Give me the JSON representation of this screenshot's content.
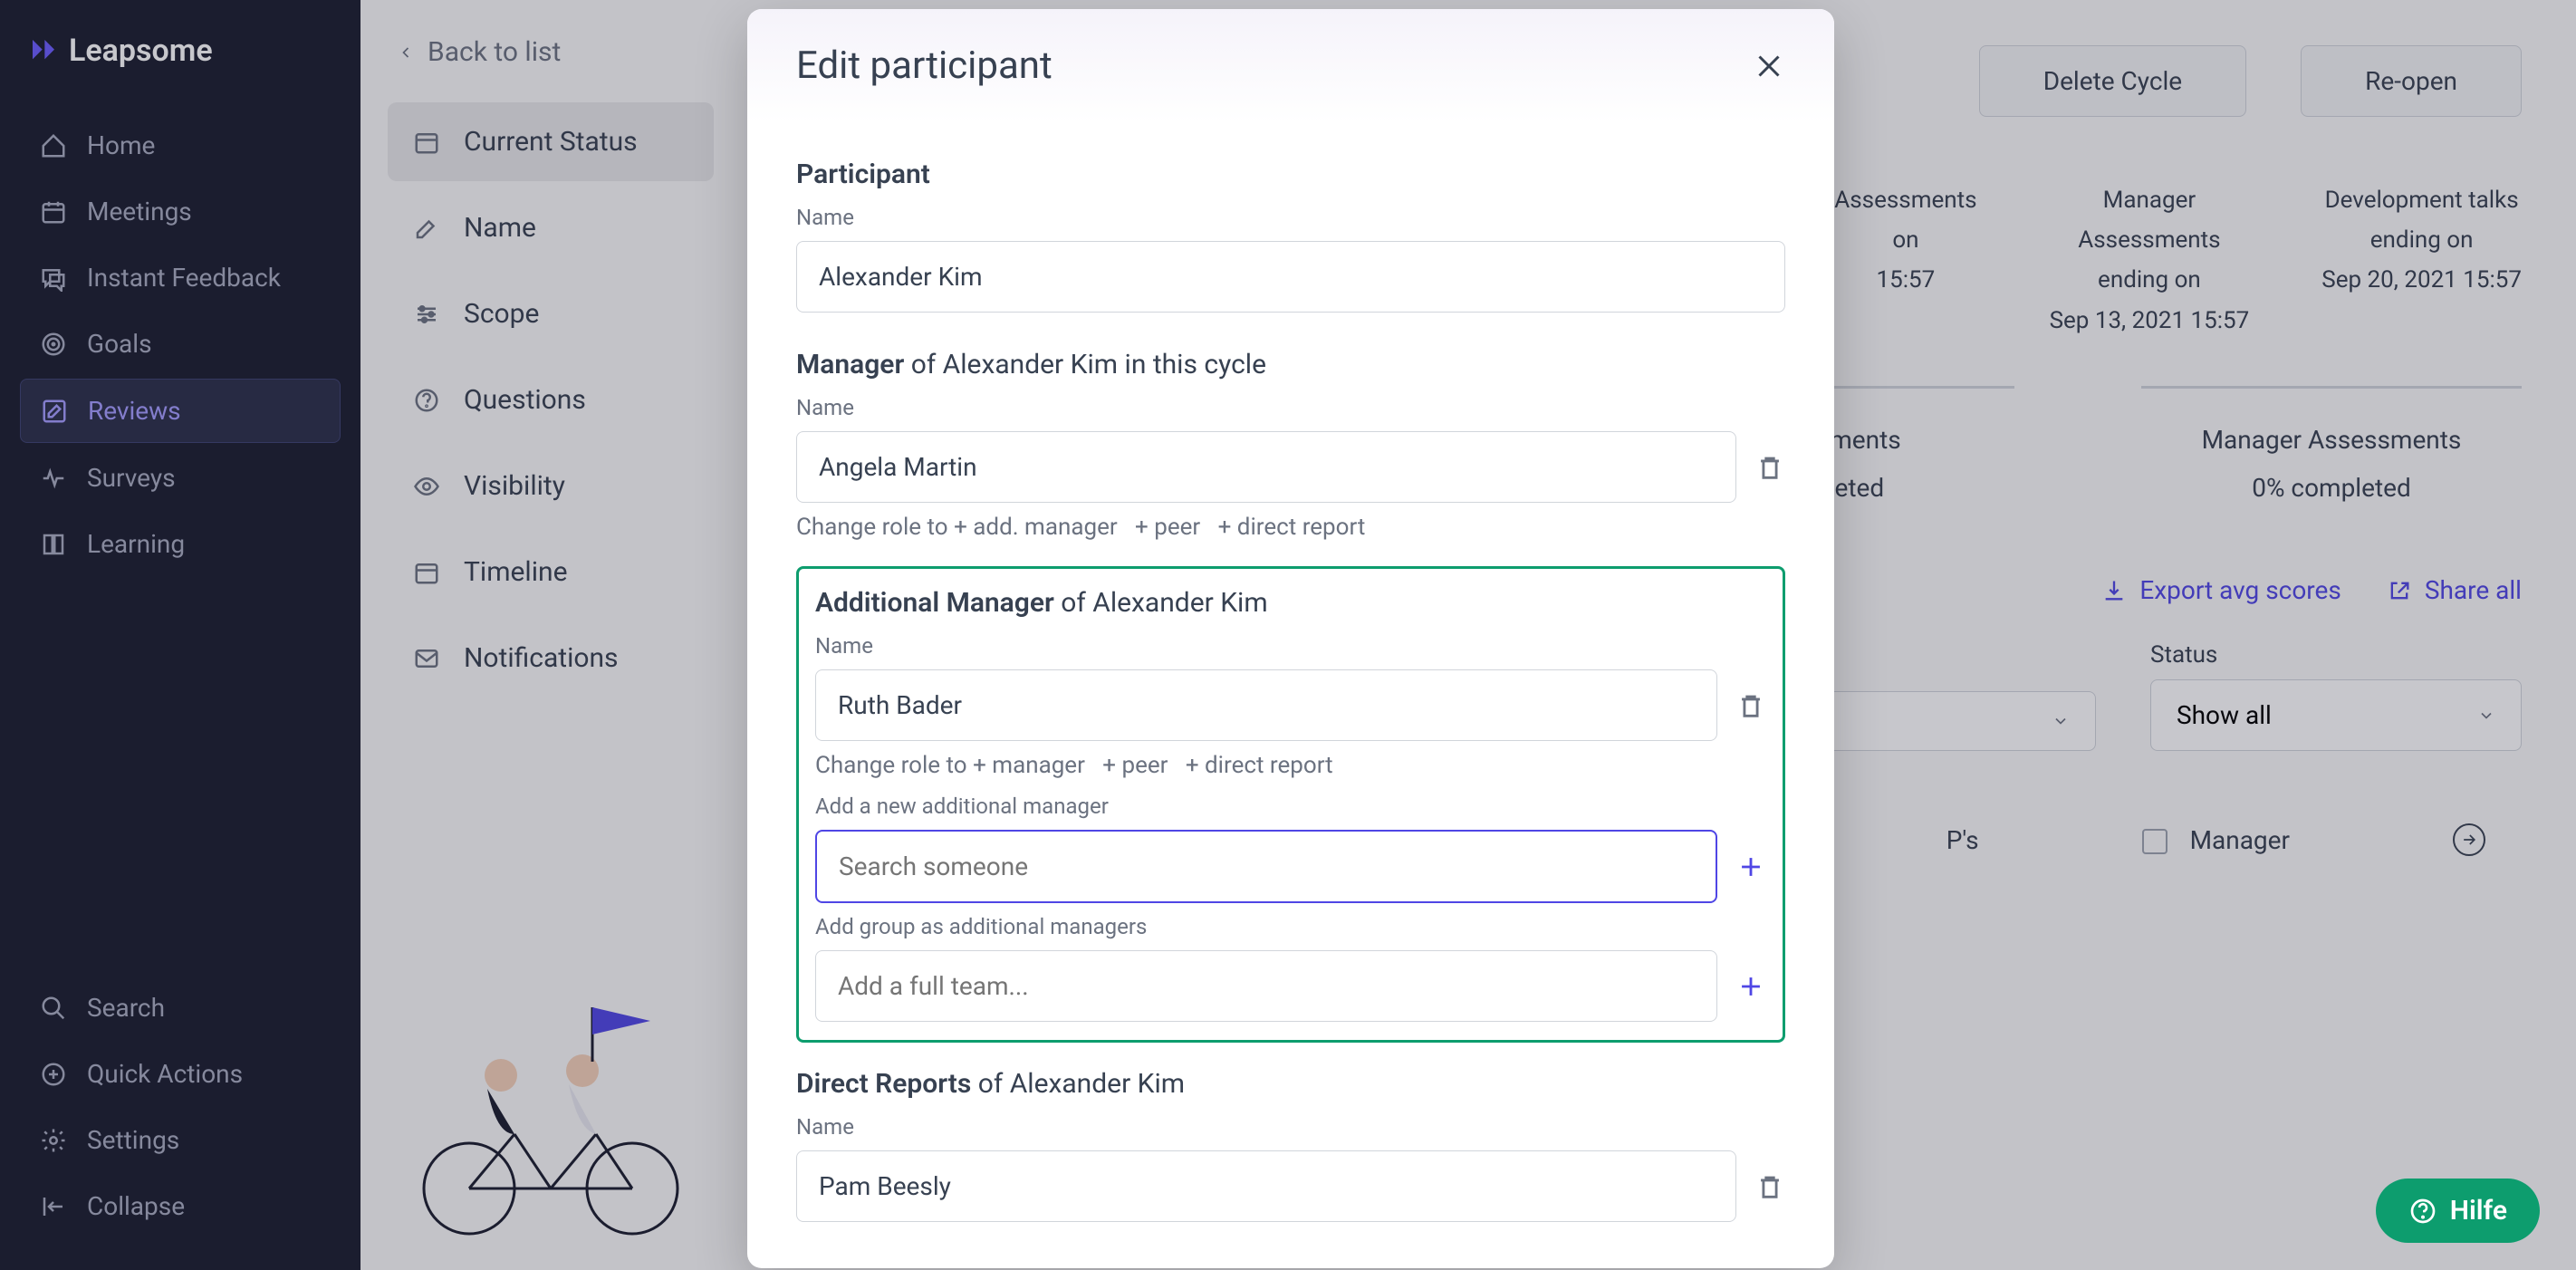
{
  "logo": "Leapsome",
  "sidebar": {
    "items": [
      {
        "label": "Home",
        "icon": "home"
      },
      {
        "label": "Meetings",
        "icon": "calendar"
      },
      {
        "label": "Instant Feedback",
        "icon": "chat"
      },
      {
        "label": "Goals",
        "icon": "target"
      },
      {
        "label": "Reviews",
        "icon": "edit",
        "active": true
      },
      {
        "label": "Surveys",
        "icon": "pulse"
      },
      {
        "label": "Learning",
        "icon": "book"
      }
    ],
    "bottom": [
      {
        "label": "Search",
        "icon": "search"
      },
      {
        "label": "Quick Actions",
        "icon": "plus-circle"
      },
      {
        "label": "Settings",
        "icon": "gear"
      },
      {
        "label": "Collapse",
        "icon": "collapse"
      }
    ]
  },
  "cycle_nav": {
    "back_label": "Back to list",
    "items": [
      {
        "label": "Current Status",
        "active": true
      },
      {
        "label": "Name"
      },
      {
        "label": "Scope"
      },
      {
        "label": "Questions"
      },
      {
        "label": "Visibility"
      },
      {
        "label": "Timeline"
      },
      {
        "label": "Notifications"
      }
    ]
  },
  "content": {
    "actions": {
      "delete": "Delete Cycle",
      "reopen": "Re-open"
    },
    "timeline": [
      {
        "l1": "Assessments",
        "l2": "on",
        "l3": "15:57"
      },
      {
        "l1": "Manager",
        "l2": "Assessments",
        "l3": "ending on",
        "l4": "Sep 13, 2021 15:57"
      },
      {
        "l1": "Development talks",
        "l2": "ending on",
        "l3": "Sep 20, 2021 15:57"
      }
    ],
    "stats": [
      {
        "title": "Assessments",
        "value": "completed"
      },
      {
        "title": "Manager Assessments",
        "value": "0% completed"
      }
    ],
    "export_links": {
      "export": "Export avg scores",
      "share": "Share all"
    },
    "filters": {
      "status_label": "Status",
      "status_value": "Show all"
    },
    "row": {
      "ps": "P's",
      "manager": "Manager"
    }
  },
  "modal": {
    "title": "Edit participant",
    "participant": {
      "heading": "Participant",
      "name_label": "Name",
      "name_value": "Alexander Kim"
    },
    "manager": {
      "heading_bold": "Manager",
      "heading_rest": "of Alexander Kim in this cycle",
      "name_label": "Name",
      "name_value": "Angela Martin",
      "role_prefix": "Change role to",
      "role1": "+ add. manager",
      "role2": "+ peer",
      "role3": "+ direct report"
    },
    "additional_manager": {
      "heading_bold": "Additional Manager",
      "heading_rest": "of Alexander Kim",
      "name_label": "Name",
      "name_value": "Ruth Bader",
      "role_prefix": "Change role to",
      "role1": "+ manager",
      "role2": "+ peer",
      "role3": "+ direct report",
      "add_new_label": "Add a new additional manager",
      "search_placeholder": "Search someone",
      "add_group_label": "Add group as additional managers",
      "team_placeholder": "Add a full team..."
    },
    "direct_reports": {
      "heading_bold": "Direct Reports",
      "heading_rest": "of Alexander Kim",
      "name_label": "Name",
      "name_value": "Pam Beesly"
    }
  },
  "help": "Hilfe"
}
